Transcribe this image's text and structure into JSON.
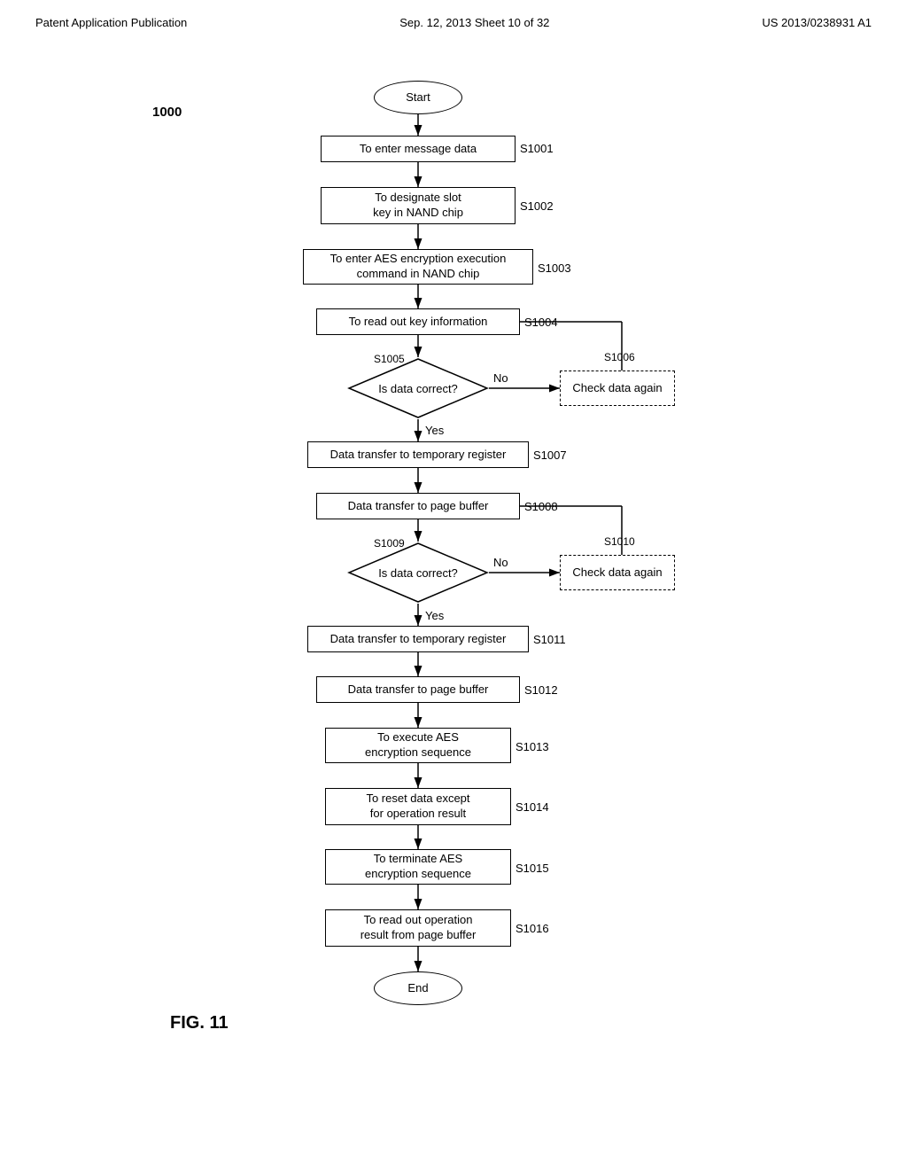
{
  "header": {
    "left": "Patent Application Publication",
    "middle": "Sep. 12, 2013   Sheet 10 of 32",
    "right": "US 2013/0238931 A1"
  },
  "diagram": {
    "ref": "1000",
    "figure": "FIG. 11",
    "nodes": [
      {
        "id": "start",
        "type": "oval",
        "label": "Start"
      },
      {
        "id": "s1001",
        "type": "rect",
        "label": "To enter message data",
        "step": "S1001"
      },
      {
        "id": "s1002",
        "type": "rect",
        "label": "To designate slot\nkey in NAND chip",
        "step": "S1002"
      },
      {
        "id": "s1003",
        "type": "rect",
        "label": "To enter AES encryption execution\ncommand in NAND chip",
        "step": "S1003"
      },
      {
        "id": "s1004",
        "type": "rect",
        "label": "To read out key information",
        "step": "S1004"
      },
      {
        "id": "s1005",
        "type": "diamond",
        "label": "Is data correct?",
        "step": "S1005"
      },
      {
        "id": "s1006",
        "type": "rect",
        "label": "Check data again",
        "step": "S1006"
      },
      {
        "id": "s1007",
        "type": "rect",
        "label": "Data transfer to temporary register",
        "step": "S1007"
      },
      {
        "id": "s1008",
        "type": "rect",
        "label": "Data transfer to page buffer",
        "step": "S1008"
      },
      {
        "id": "s1009",
        "type": "diamond",
        "label": "Is data correct?",
        "step": "S1009"
      },
      {
        "id": "s1010",
        "type": "rect",
        "label": "Check data again",
        "step": "S1010"
      },
      {
        "id": "s1011",
        "type": "rect",
        "label": "Data transfer to temporary register",
        "step": "S1011"
      },
      {
        "id": "s1012",
        "type": "rect",
        "label": "Data transfer to page buffer",
        "step": "S1012"
      },
      {
        "id": "s1013",
        "type": "rect",
        "label": "To execute AES\nencryption sequence",
        "step": "S1013"
      },
      {
        "id": "s1014",
        "type": "rect",
        "label": "To reset data except\nfor operation result",
        "step": "S1014"
      },
      {
        "id": "s1015",
        "type": "rect",
        "label": "To terminate AES\nencryption sequence",
        "step": "S1015"
      },
      {
        "id": "s1016",
        "type": "rect",
        "label": "To read out operation\nresult from page buffer",
        "step": "S1016"
      },
      {
        "id": "end",
        "type": "oval",
        "label": "End"
      }
    ],
    "labels": {
      "yes": "Yes",
      "no": "No"
    }
  }
}
